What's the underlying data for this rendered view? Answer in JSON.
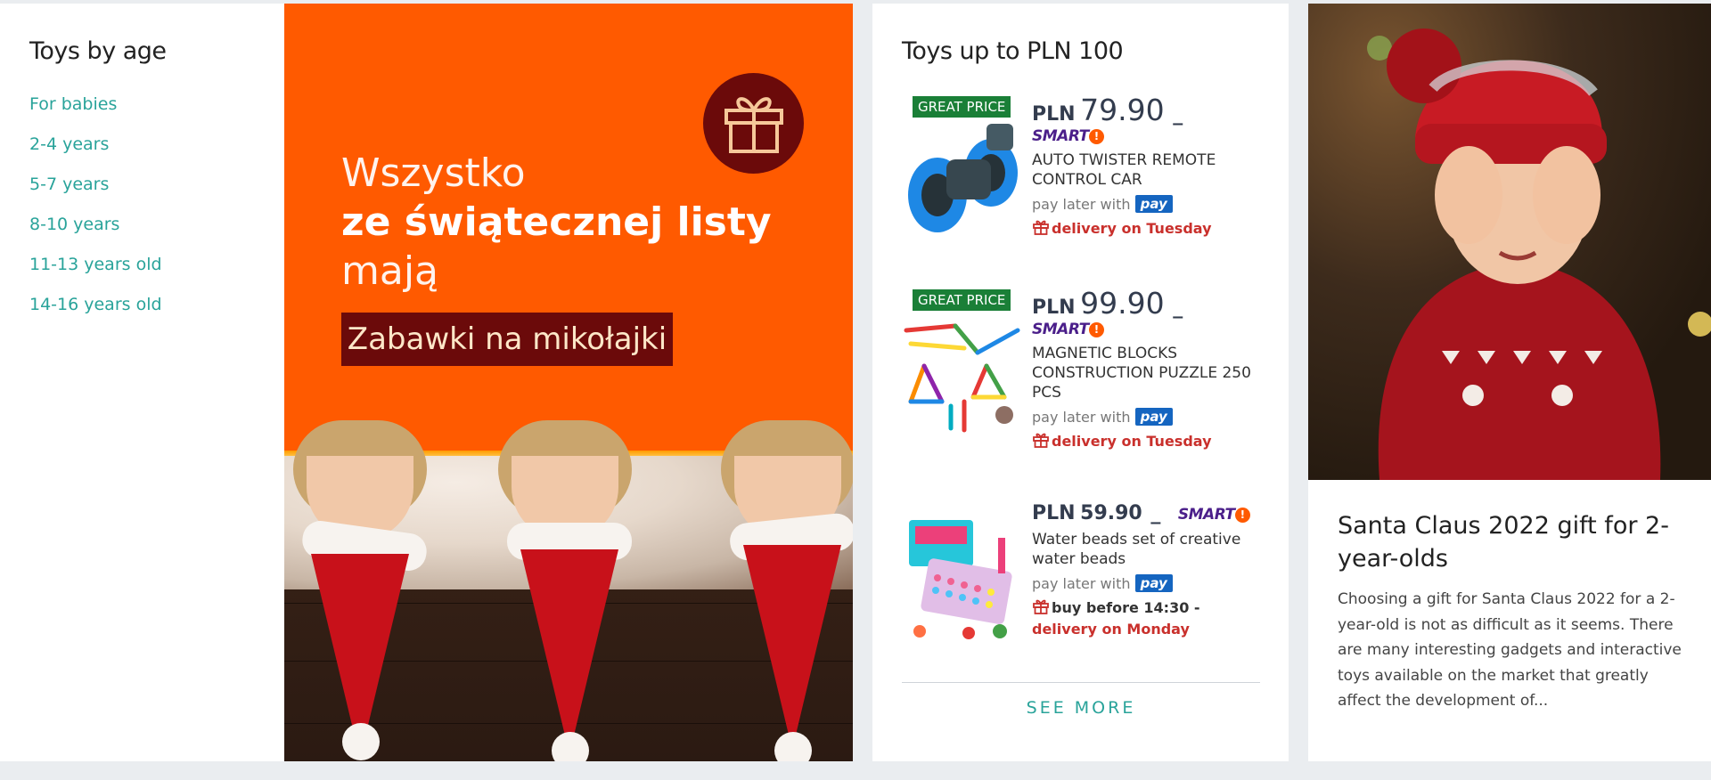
{
  "age_section": {
    "title": "Toys by age",
    "links": [
      "For babies",
      "2-4 years",
      "5-7 years",
      "8-10 years",
      "11-13 years old",
      "14-16 years old"
    ]
  },
  "banner": {
    "line1": "Wszystko",
    "line2": "ze świątecznej listy",
    "line3": "mają",
    "cta": "Zabawki na mikołajki",
    "icon": "gift-icon"
  },
  "toys_section": {
    "title": "Toys up to PLN 100",
    "products": [
      {
        "badge": "GREAT PRICE",
        "currency": "PLN",
        "price": "79.90",
        "smart": "SMART",
        "name": "AUTO TWISTER REMOTE CONTROL CAR",
        "pay_later": "pay later with",
        "pay_logo": "pay",
        "delivery": "delivery on Tuesday",
        "delivery_prefix": ""
      },
      {
        "badge": "GREAT PRICE",
        "currency": "PLN",
        "price": "99.90",
        "smart": "SMART",
        "name": "MAGNETIC BLOCKS CONSTRUCTION PUZZLE 250 PCS",
        "pay_later": "pay later with",
        "pay_logo": "pay",
        "delivery": "delivery on Tuesday",
        "delivery_prefix": ""
      },
      {
        "badge": "",
        "currency": "PLN",
        "price": "59.90",
        "smart": "SMART",
        "name": "Water beads set of creative water beads",
        "pay_later": "pay later with",
        "pay_logo": "pay",
        "delivery": "delivery on Monday",
        "delivery_prefix": "buy before 14:30 - "
      }
    ],
    "see_more": "SEE MORE"
  },
  "article": {
    "title": "Santa Claus 2022 gift for 2-year-olds",
    "excerpt": "Choosing a gift for Santa Claus 2022 for a 2-year-old is not as difficult as it seems. There are many interesting gadgets and interactive toys available on the market that greatly affect the development of..."
  },
  "colors": {
    "link": "#29a39a",
    "banner_bg": "#ff5a00",
    "badge_green": "#1a7f37",
    "delivery_red": "#c9302c",
    "smart_purple": "#4b1f8a",
    "pay_blue": "#1565c0"
  }
}
